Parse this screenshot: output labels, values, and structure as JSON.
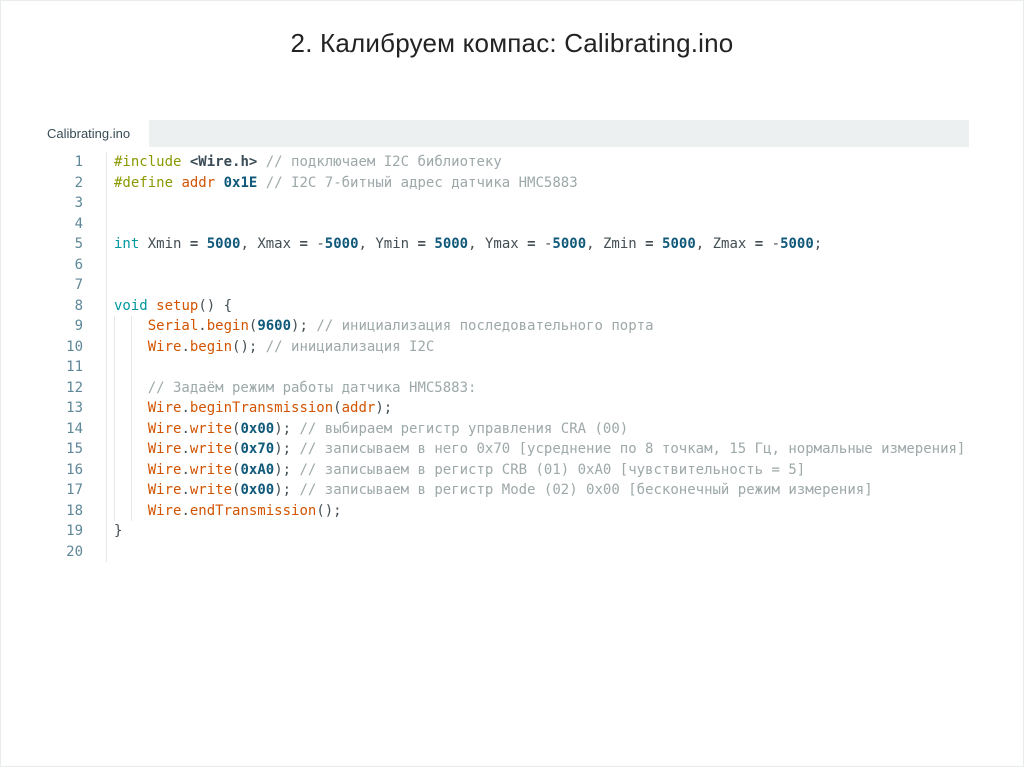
{
  "title": "2. Калибруем компас: Calibrating.ino",
  "editor": {
    "tab_label": "Calibrating.ino",
    "colors": {
      "tab_bar_bg": "#edf0f0",
      "tab_active_bg": "#ffffff",
      "default_text": "#434f54",
      "directive": "#8a9900",
      "keyword": "#00979d",
      "function_builtin": "#d35400",
      "number": "#10597a",
      "include_string": "#3a4b55",
      "comment": "#9da8a9",
      "line_number": "#5e8798",
      "gutter_separator": "#e2e7e7",
      "indent_guide": "#e3e8e8"
    },
    "lines": [
      {
        "n": "1",
        "g": false,
        "t": [
          [
            "dir",
            "#include"
          ],
          [
            "d",
            " "
          ],
          [
            "str",
            "<Wire.h>"
          ],
          [
            "d",
            " "
          ],
          [
            "cmt",
            "// подключаем I2C библиотеку"
          ]
        ]
      },
      {
        "n": "2",
        "g": false,
        "t": [
          [
            "dir",
            "#define"
          ],
          [
            "d",
            " "
          ],
          [
            "fn",
            "addr"
          ],
          [
            "d",
            " "
          ],
          [
            "num",
            "0x1E"
          ],
          [
            "d",
            " "
          ],
          [
            "cmt",
            "// I2C 7-битный адрес датчика HMC5883"
          ]
        ]
      },
      {
        "n": "3",
        "g": false,
        "t": []
      },
      {
        "n": "4",
        "g": false,
        "t": []
      },
      {
        "n": "5",
        "g": false,
        "t": [
          [
            "kw",
            "int"
          ],
          [
            "d",
            " Xmin "
          ],
          [
            "op",
            "="
          ],
          [
            "d",
            " "
          ],
          [
            "num",
            "5000"
          ],
          [
            "d",
            ", Xmax "
          ],
          [
            "op",
            "="
          ],
          [
            "d",
            " -"
          ],
          [
            "num",
            "5000"
          ],
          [
            "d",
            ", Ymin "
          ],
          [
            "op",
            "="
          ],
          [
            "d",
            " "
          ],
          [
            "num",
            "5000"
          ],
          [
            "d",
            ", Ymax "
          ],
          [
            "op",
            "="
          ],
          [
            "d",
            " -"
          ],
          [
            "num",
            "5000"
          ],
          [
            "d",
            ", Zmin "
          ],
          [
            "op",
            "="
          ],
          [
            "d",
            " "
          ],
          [
            "num",
            "5000"
          ],
          [
            "d",
            ", Zmax "
          ],
          [
            "op",
            "="
          ],
          [
            "d",
            " -"
          ],
          [
            "num",
            "5000"
          ],
          [
            "d",
            ";"
          ]
        ]
      },
      {
        "n": "6",
        "g": false,
        "t": []
      },
      {
        "n": "7",
        "g": false,
        "t": []
      },
      {
        "n": "8",
        "g": false,
        "t": [
          [
            "kw",
            "void"
          ],
          [
            "d",
            " "
          ],
          [
            "fn",
            "setup"
          ],
          [
            "d",
            "() {"
          ]
        ]
      },
      {
        "n": "9",
        "g": true,
        "t": [
          [
            "d",
            "    "
          ],
          [
            "fn",
            "Serial"
          ],
          [
            "d",
            "."
          ],
          [
            "fn",
            "begin"
          ],
          [
            "d",
            "("
          ],
          [
            "num",
            "9600"
          ],
          [
            "d",
            "); "
          ],
          [
            "cmt",
            "// инициализация последовательного порта"
          ]
        ]
      },
      {
        "n": "10",
        "g": true,
        "t": [
          [
            "d",
            "    "
          ],
          [
            "fn",
            "Wire"
          ],
          [
            "d",
            "."
          ],
          [
            "fn",
            "begin"
          ],
          [
            "d",
            "(); "
          ],
          [
            "cmt",
            "// инициализация I2C"
          ]
        ]
      },
      {
        "n": "11",
        "g": true,
        "t": []
      },
      {
        "n": "12",
        "g": true,
        "t": [
          [
            "d",
            "    "
          ],
          [
            "cmt",
            "// Задаём режим работы датчика HMC5883:"
          ]
        ]
      },
      {
        "n": "13",
        "g": true,
        "t": [
          [
            "d",
            "    "
          ],
          [
            "fn",
            "Wire"
          ],
          [
            "d",
            "."
          ],
          [
            "fn",
            "beginTransmission"
          ],
          [
            "d",
            "("
          ],
          [
            "fn",
            "addr"
          ],
          [
            "d",
            ");"
          ]
        ]
      },
      {
        "n": "14",
        "g": true,
        "t": [
          [
            "d",
            "    "
          ],
          [
            "fn",
            "Wire"
          ],
          [
            "d",
            "."
          ],
          [
            "fn",
            "write"
          ],
          [
            "d",
            "("
          ],
          [
            "num",
            "0x00"
          ],
          [
            "d",
            "); "
          ],
          [
            "cmt",
            "// выбираем регистр управления CRA (00)"
          ]
        ]
      },
      {
        "n": "15",
        "g": true,
        "t": [
          [
            "d",
            "    "
          ],
          [
            "fn",
            "Wire"
          ],
          [
            "d",
            "."
          ],
          [
            "fn",
            "write"
          ],
          [
            "d",
            "("
          ],
          [
            "num",
            "0x70"
          ],
          [
            "d",
            "); "
          ],
          [
            "cmt",
            "// записываем в него 0x70 [усреднение по 8 точкам, 15 Гц, нормальные измерения]"
          ]
        ]
      },
      {
        "n": "16",
        "g": true,
        "t": [
          [
            "d",
            "    "
          ],
          [
            "fn",
            "Wire"
          ],
          [
            "d",
            "."
          ],
          [
            "fn",
            "write"
          ],
          [
            "d",
            "("
          ],
          [
            "num",
            "0xA0"
          ],
          [
            "d",
            "); "
          ],
          [
            "cmt",
            "// записываем в регистр CRB (01) 0xA0 [чувствительность = 5]"
          ]
        ]
      },
      {
        "n": "17",
        "g": true,
        "t": [
          [
            "d",
            "    "
          ],
          [
            "fn",
            "Wire"
          ],
          [
            "d",
            "."
          ],
          [
            "fn",
            "write"
          ],
          [
            "d",
            "("
          ],
          [
            "num",
            "0x00"
          ],
          [
            "d",
            "); "
          ],
          [
            "cmt",
            "// записываем в регистр Mode (02) 0x00 [бесконечный режим измерения]"
          ]
        ]
      },
      {
        "n": "18",
        "g": true,
        "t": [
          [
            "d",
            "    "
          ],
          [
            "fn",
            "Wire"
          ],
          [
            "d",
            "."
          ],
          [
            "fn",
            "endTransmission"
          ],
          [
            "d",
            "();"
          ]
        ]
      },
      {
        "n": "19",
        "g": false,
        "t": [
          [
            "d",
            "}"
          ]
        ]
      },
      {
        "n": "20",
        "g": false,
        "t": []
      }
    ]
  }
}
